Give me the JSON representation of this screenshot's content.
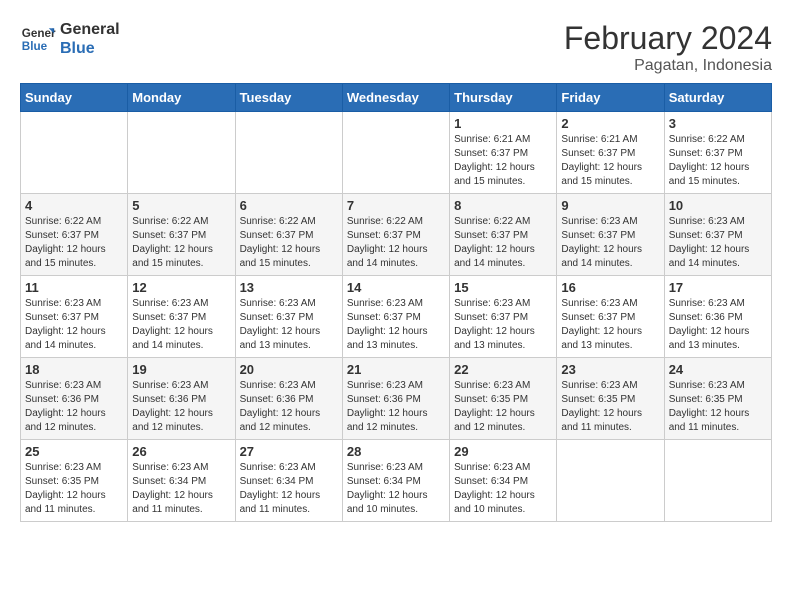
{
  "header": {
    "logo_line1": "General",
    "logo_line2": "Blue",
    "month_year": "February 2024",
    "location": "Pagatan, Indonesia"
  },
  "weekdays": [
    "Sunday",
    "Monday",
    "Tuesday",
    "Wednesday",
    "Thursday",
    "Friday",
    "Saturday"
  ],
  "weeks": [
    [
      {
        "day": "",
        "info": ""
      },
      {
        "day": "",
        "info": ""
      },
      {
        "day": "",
        "info": ""
      },
      {
        "day": "",
        "info": ""
      },
      {
        "day": "1",
        "info": "Sunrise: 6:21 AM\nSunset: 6:37 PM\nDaylight: 12 hours and 15 minutes."
      },
      {
        "day": "2",
        "info": "Sunrise: 6:21 AM\nSunset: 6:37 PM\nDaylight: 12 hours and 15 minutes."
      },
      {
        "day": "3",
        "info": "Sunrise: 6:22 AM\nSunset: 6:37 PM\nDaylight: 12 hours and 15 minutes."
      }
    ],
    [
      {
        "day": "4",
        "info": "Sunrise: 6:22 AM\nSunset: 6:37 PM\nDaylight: 12 hours and 15 minutes."
      },
      {
        "day": "5",
        "info": "Sunrise: 6:22 AM\nSunset: 6:37 PM\nDaylight: 12 hours and 15 minutes."
      },
      {
        "day": "6",
        "info": "Sunrise: 6:22 AM\nSunset: 6:37 PM\nDaylight: 12 hours and 15 minutes."
      },
      {
        "day": "7",
        "info": "Sunrise: 6:22 AM\nSunset: 6:37 PM\nDaylight: 12 hours and 14 minutes."
      },
      {
        "day": "8",
        "info": "Sunrise: 6:22 AM\nSunset: 6:37 PM\nDaylight: 12 hours and 14 minutes."
      },
      {
        "day": "9",
        "info": "Sunrise: 6:23 AM\nSunset: 6:37 PM\nDaylight: 12 hours and 14 minutes."
      },
      {
        "day": "10",
        "info": "Sunrise: 6:23 AM\nSunset: 6:37 PM\nDaylight: 12 hours and 14 minutes."
      }
    ],
    [
      {
        "day": "11",
        "info": "Sunrise: 6:23 AM\nSunset: 6:37 PM\nDaylight: 12 hours and 14 minutes."
      },
      {
        "day": "12",
        "info": "Sunrise: 6:23 AM\nSunset: 6:37 PM\nDaylight: 12 hours and 14 minutes."
      },
      {
        "day": "13",
        "info": "Sunrise: 6:23 AM\nSunset: 6:37 PM\nDaylight: 12 hours and 13 minutes."
      },
      {
        "day": "14",
        "info": "Sunrise: 6:23 AM\nSunset: 6:37 PM\nDaylight: 12 hours and 13 minutes."
      },
      {
        "day": "15",
        "info": "Sunrise: 6:23 AM\nSunset: 6:37 PM\nDaylight: 12 hours and 13 minutes."
      },
      {
        "day": "16",
        "info": "Sunrise: 6:23 AM\nSunset: 6:37 PM\nDaylight: 12 hours and 13 minutes."
      },
      {
        "day": "17",
        "info": "Sunrise: 6:23 AM\nSunset: 6:36 PM\nDaylight: 12 hours and 13 minutes."
      }
    ],
    [
      {
        "day": "18",
        "info": "Sunrise: 6:23 AM\nSunset: 6:36 PM\nDaylight: 12 hours and 12 minutes."
      },
      {
        "day": "19",
        "info": "Sunrise: 6:23 AM\nSunset: 6:36 PM\nDaylight: 12 hours and 12 minutes."
      },
      {
        "day": "20",
        "info": "Sunrise: 6:23 AM\nSunset: 6:36 PM\nDaylight: 12 hours and 12 minutes."
      },
      {
        "day": "21",
        "info": "Sunrise: 6:23 AM\nSunset: 6:36 PM\nDaylight: 12 hours and 12 minutes."
      },
      {
        "day": "22",
        "info": "Sunrise: 6:23 AM\nSunset: 6:35 PM\nDaylight: 12 hours and 12 minutes."
      },
      {
        "day": "23",
        "info": "Sunrise: 6:23 AM\nSunset: 6:35 PM\nDaylight: 12 hours and 11 minutes."
      },
      {
        "day": "24",
        "info": "Sunrise: 6:23 AM\nSunset: 6:35 PM\nDaylight: 12 hours and 11 minutes."
      }
    ],
    [
      {
        "day": "25",
        "info": "Sunrise: 6:23 AM\nSunset: 6:35 PM\nDaylight: 12 hours and 11 minutes."
      },
      {
        "day": "26",
        "info": "Sunrise: 6:23 AM\nSunset: 6:34 PM\nDaylight: 12 hours and 11 minutes."
      },
      {
        "day": "27",
        "info": "Sunrise: 6:23 AM\nSunset: 6:34 PM\nDaylight: 12 hours and 11 minutes."
      },
      {
        "day": "28",
        "info": "Sunrise: 6:23 AM\nSunset: 6:34 PM\nDaylight: 12 hours and 10 minutes."
      },
      {
        "day": "29",
        "info": "Sunrise: 6:23 AM\nSunset: 6:34 PM\nDaylight: 12 hours and 10 minutes."
      },
      {
        "day": "",
        "info": ""
      },
      {
        "day": "",
        "info": ""
      }
    ]
  ]
}
